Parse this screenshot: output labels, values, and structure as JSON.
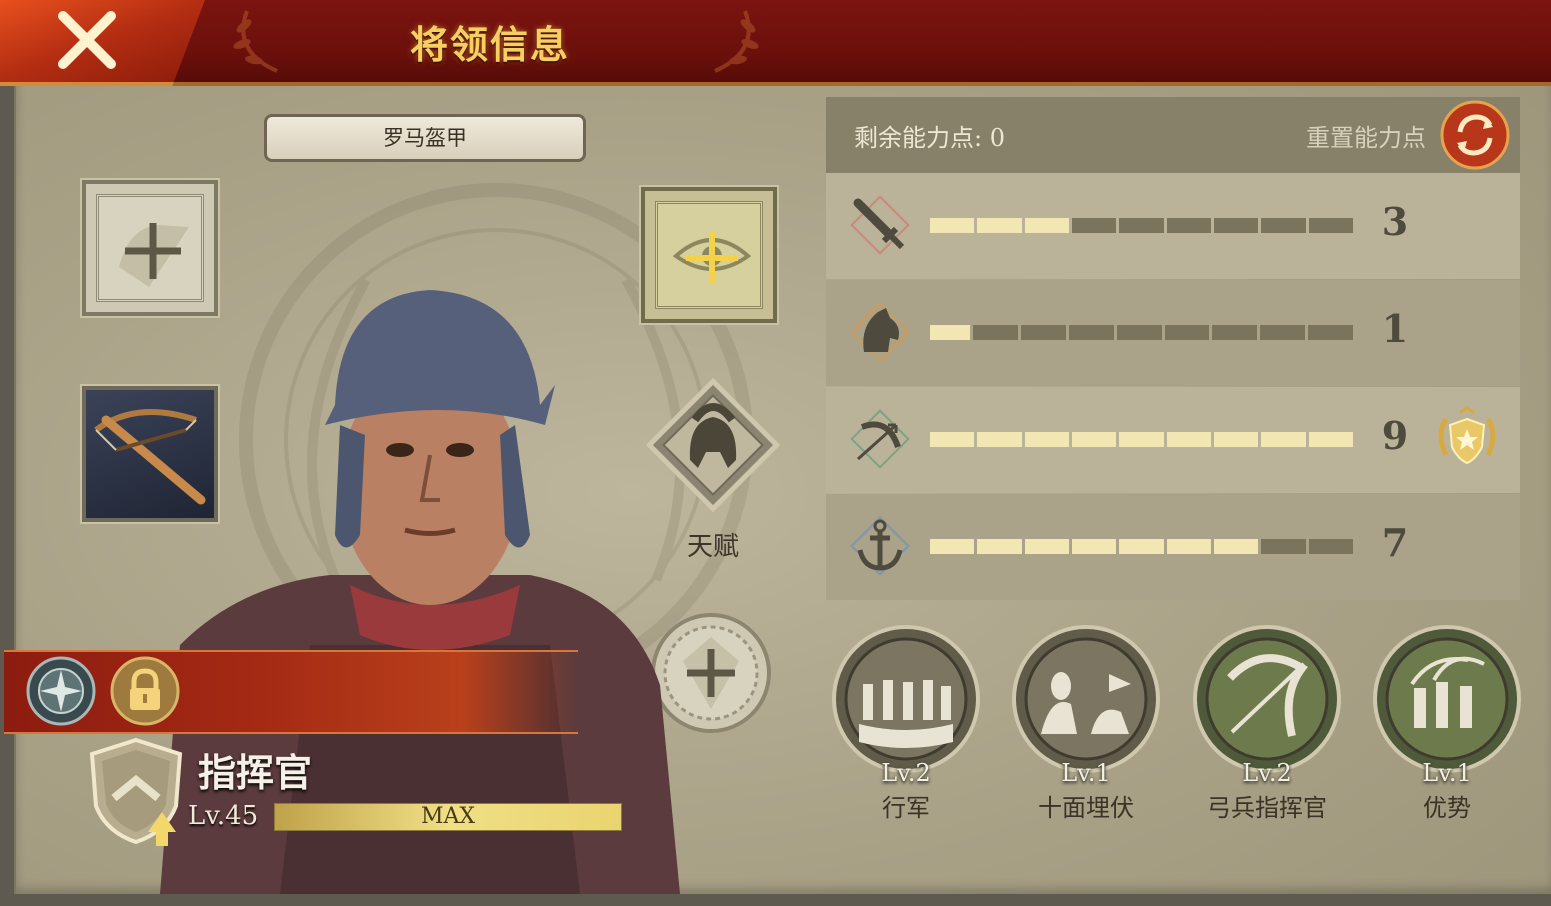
{
  "header": {
    "title": "将领信息",
    "close_icon": "close-icon"
  },
  "equipment": {
    "armor_name": "罗马盔甲",
    "slots": [
      {
        "name": "scroll-slot",
        "icon": "plus-icon"
      },
      {
        "name": "crossbow-slot",
        "icon": "crossbow-icon"
      },
      {
        "name": "eye-slot",
        "icon": "plus-icon"
      },
      {
        "name": "gem-slot",
        "icon": "plus-icon"
      }
    ],
    "talent_label": "天赋"
  },
  "commander": {
    "rank_title": "指挥官",
    "level": "Lv.45",
    "xp_label": "MAX",
    "xp_fraction": 1.0
  },
  "stats": {
    "points_label": "剩余能力点: 0",
    "reset_label": "重置能力点",
    "max_segments": 9,
    "rows": [
      {
        "icon": "sword-icon",
        "value": "3",
        "filled": 3
      },
      {
        "icon": "horse-icon",
        "value": "1",
        "filled": 1
      },
      {
        "icon": "bow-icon",
        "value": "9",
        "filled": 9,
        "medal": "laurel-star-medal-icon"
      },
      {
        "icon": "anchor-icon",
        "value": "7",
        "filled": 7
      }
    ]
  },
  "skills": [
    {
      "level": "Lv.2",
      "name": "行军"
    },
    {
      "level": "Lv.1",
      "name": "十面埋伏"
    },
    {
      "level": "Lv.2",
      "name": "弓兵指挥官"
    },
    {
      "level": "Lv.1",
      "name": "优势"
    }
  ],
  "colors": {
    "title_gold": "#f6cf62",
    "banner_red": "#a52a14",
    "bar_on": "#f2e7b3",
    "bar_off": "#7b745d"
  }
}
